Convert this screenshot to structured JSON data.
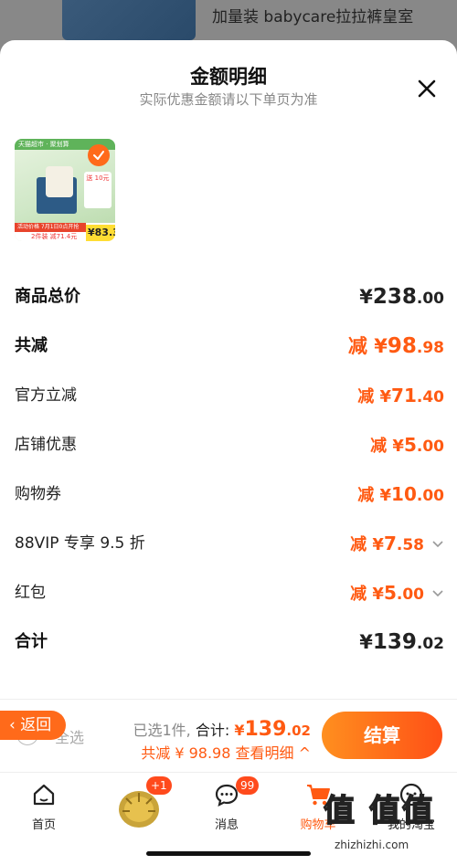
{
  "background": {
    "product_title": "加量装 babycare拉拉裤皇室"
  },
  "sheet": {
    "title": "金额明细",
    "subtitle": "实际优惠金额请以下单页为准",
    "product": {
      "badge_text": "天猫超市 · 聚划算",
      "coupon_text": "送 10元",
      "promo_strip": "活动价格 7月1日0点开抢",
      "promo_line": "2件装 减71.4元",
      "final_price": "83.3"
    },
    "rows": [
      {
        "label": "商品总价",
        "prefix": "¥",
        "int": "238",
        "dec": ".00",
        "color": "#222222",
        "bold": true,
        "chevron": false
      },
      {
        "label": "共减",
        "prefix": "减 ¥",
        "int": "98",
        "dec": ".98",
        "color": "#ff5a12",
        "bold": true,
        "chevron": false
      },
      {
        "label": "官方立减",
        "prefix": "减 ¥",
        "int": "71",
        "dec": ".40",
        "color": "#ff5a12",
        "bold": false,
        "chevron": false
      },
      {
        "label": "店铺优惠",
        "prefix": "减 ¥",
        "int": "5",
        "dec": ".00",
        "color": "#ff5a12",
        "bold": false,
        "chevron": false
      },
      {
        "label": "购物券",
        "prefix": "减 ¥",
        "int": "10",
        "dec": ".00",
        "color": "#ff5a12",
        "bold": false,
        "chevron": false
      },
      {
        "label": "88VIP 专享 9.5 折",
        "prefix": "减 ¥",
        "int": "7",
        "dec": ".58",
        "color": "#ff5a12",
        "bold": false,
        "chevron": true
      },
      {
        "label": "红包",
        "prefix": "减 ¥",
        "int": "5",
        "dec": ".00",
        "color": "#ff5a12",
        "bold": false,
        "chevron": true
      },
      {
        "label": "合计",
        "prefix": "¥",
        "int": "139",
        "dec": ".02",
        "color": "#222222",
        "bold": true,
        "chevron": false
      }
    ]
  },
  "bottom_bar": {
    "back_label": "返回",
    "select_all_label": "全选",
    "selected_count": "已选1件,",
    "total_label": "合计:",
    "total_prefix": "¥",
    "total_int": "139",
    "total_dec": ".02",
    "reduce_text": "共减 ¥ 98.98 查看明细",
    "checkout_label": "结算"
  },
  "tabbar": {
    "items": [
      {
        "label": "首页",
        "icon": "home-icon",
        "active": false
      },
      {
        "label": "",
        "icon": "durian-icon",
        "active": false,
        "badge": "+1"
      },
      {
        "label": "消息",
        "icon": "message-icon",
        "active": false,
        "badge": "99"
      },
      {
        "label": "购物车",
        "icon": "cart-icon",
        "active": true
      },
      {
        "label": "我的淘宝",
        "icon": "profile-icon",
        "active": false
      }
    ]
  },
  "watermark": {
    "site": "zhizhizhi.com",
    "mark": "值 值值"
  },
  "colors": {
    "accent": "#ff5a12",
    "checkout_start": "#ff8f1f",
    "checkout_end": "#ff5016"
  }
}
